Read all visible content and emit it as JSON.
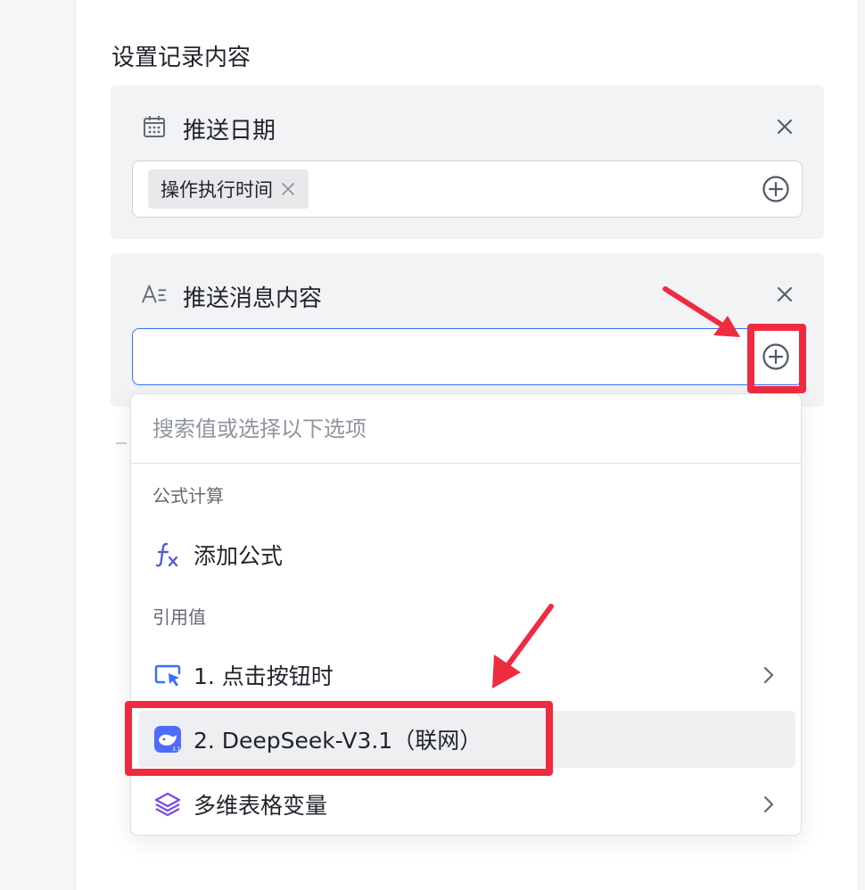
{
  "section": {
    "title": "设置记录内容"
  },
  "cards": [
    {
      "title": "推送日期",
      "icon": "calendar-icon",
      "chip": "操作执行时间"
    },
    {
      "title": "推送消息内容",
      "icon": "text-format-icon",
      "value": ""
    }
  ],
  "dropdown": {
    "search_placeholder": "搜索值或选择以下选项",
    "groups": [
      {
        "label": "公式计算",
        "items": [
          {
            "label": "添加公式",
            "icon": "formula-fx-icon",
            "has_submenu": false
          }
        ]
      },
      {
        "label": "引用值",
        "items": [
          {
            "label": "1. 点击按钮时",
            "icon": "cursor-click-icon",
            "has_submenu": true
          },
          {
            "label": "2. DeepSeek-V3.1（联网）",
            "icon": "deepseek-whale-icon",
            "has_submenu": false,
            "hovered": true
          },
          {
            "label": "多维表格变量",
            "icon": "layers-icon",
            "has_submenu": true
          }
        ]
      }
    ]
  },
  "colors": {
    "accent": "#3370ff",
    "annotation": "#ef2b3f",
    "formula_icon": "#5b5bd6",
    "layers_icon": "#7b4de0"
  }
}
